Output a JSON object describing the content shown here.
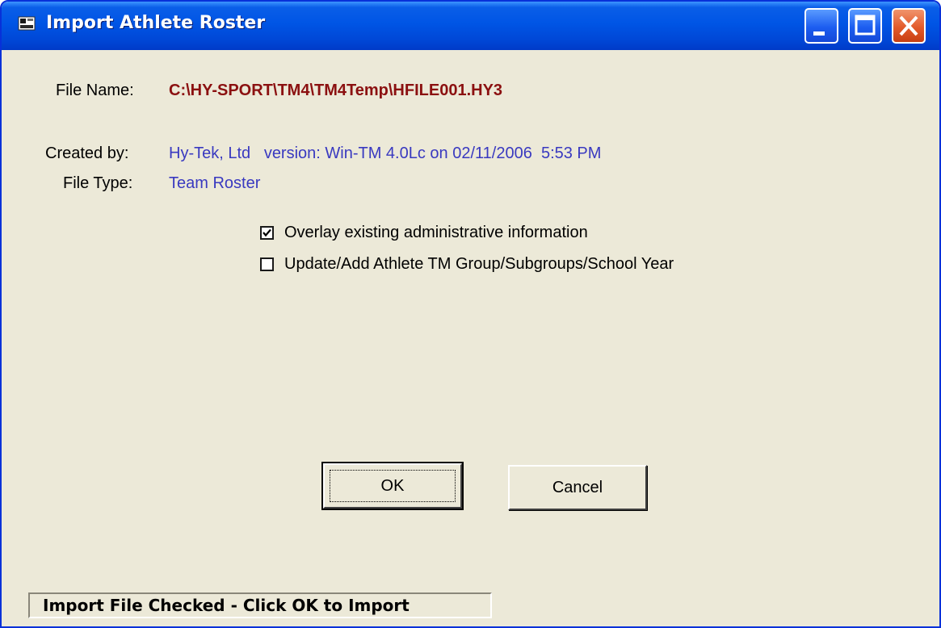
{
  "window": {
    "title": "Import Athlete Roster",
    "controls": {
      "minimize_icon": "minimize-icon",
      "maximize_icon": "maximize-icon",
      "close_icon": "close-icon"
    },
    "colors": {
      "titlebar": "#0055e5",
      "close_button": "#e35a2a",
      "body": "#ece9d8"
    }
  },
  "file_info": {
    "file_name_label": "File Name:",
    "file_name_value": "C:\\HY-SPORT\\TM4\\TM4Temp\\HFILE001.HY3",
    "created_by_label": "Created by:",
    "created_by_value": "Hy-Tek, Ltd   version: Win-TM 4.0Lc on 02/11/2006  5:53 PM",
    "file_type_label": "File Type:",
    "file_type_value": "Team Roster"
  },
  "options": [
    {
      "label": "Overlay existing administrative information",
      "checked": true
    },
    {
      "label": "Update/Add Athlete TM Group/Subgroups/School Year",
      "checked": false
    }
  ],
  "buttons": {
    "ok_label": "OK",
    "cancel_label": "Cancel"
  },
  "status": {
    "text": "Import File Checked - Click OK to Import"
  }
}
